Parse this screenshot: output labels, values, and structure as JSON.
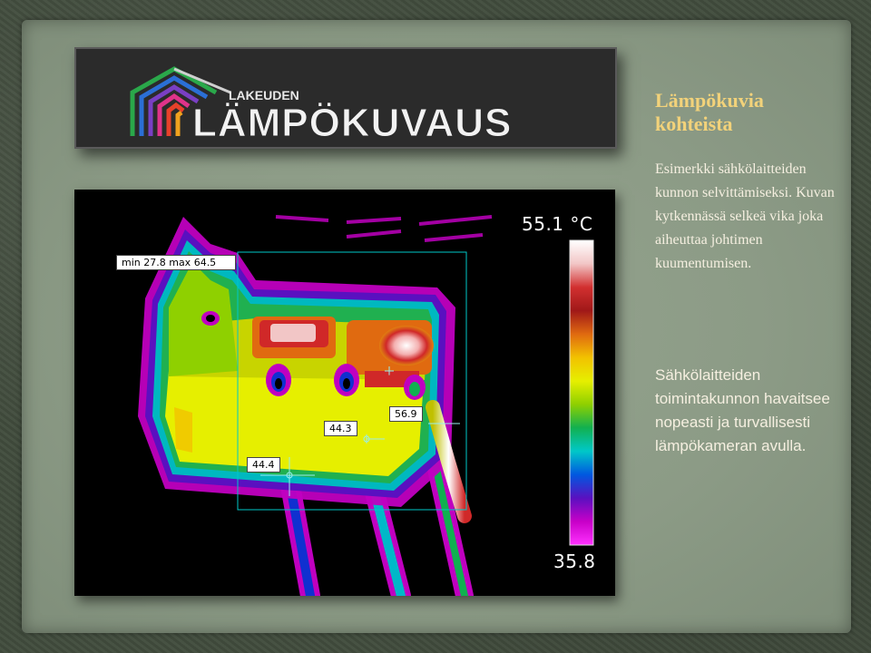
{
  "slide": {
    "title": "Lämpökuvia kohteista",
    "paragraph1": "Esimerkki sähkölaitteiden kunnon selvittämiseksi. Kuvan kytkennässä selkeä vika joka aiheuttaa johtimen kuumentumisen.",
    "paragraph2": "Sähkölaitteiden toimintakunnon havaitsee nopeasti ja turvallisesti lämpökameran avulla."
  },
  "logo": {
    "small_text": "LAKEUDEN",
    "big_text": "LÄMPÖKUVAUS",
    "stripe_colors": [
      "#2aa84a",
      "#2b6fd6",
      "#7a3fc4",
      "#e0338a",
      "#e8412a",
      "#f0a21e"
    ]
  },
  "thermal": {
    "scale_max": "55.1 °C",
    "scale_min": "35.8",
    "minmax_label": "min 27.8 max 64.5",
    "spot1": "56.9",
    "spot2": "44.3",
    "spot3": "44.4",
    "palette": [
      "#ffffff",
      "#f2c6c6",
      "#d23030",
      "#a01818",
      "#e06a10",
      "#f2c200",
      "#e6ef00",
      "#8fd000",
      "#12b050",
      "#00c8c8",
      "#0058e0",
      "#5a10c0",
      "#c800c8",
      "#ff30ff"
    ]
  }
}
